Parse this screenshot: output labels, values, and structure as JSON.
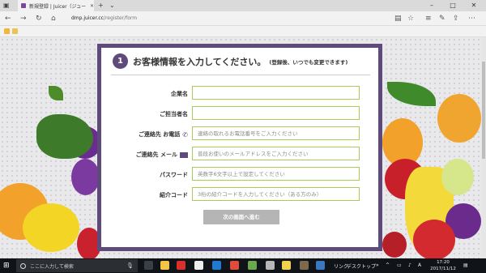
{
  "browser": {
    "tab_title": "新規登録 | Juicer（ジュー",
    "new_tab_symbol": "+",
    "url_domain": "dmp.juicer.cc",
    "url_path": "/register/form"
  },
  "form": {
    "step_number": "1",
    "title": "お客様情報を入力してください。",
    "note": "(登録後、いつでも変更できます)",
    "fields": [
      {
        "label": "企業名",
        "placeholder": ""
      },
      {
        "label": "ご担当者名",
        "placeholder": ""
      },
      {
        "label": "ご連絡先 お電話",
        "placeholder": "連絡の取れるお電話番号をご入力ください"
      },
      {
        "label": "ご連絡先 メール",
        "placeholder": "普段お使いのメールアドレスをご入力ください"
      },
      {
        "label": "パスワード",
        "placeholder": "英数字6文字以上で設定してください"
      },
      {
        "label": "紹介コード",
        "placeholder": "3桁の紹介コードを入力してください（ある方のみ）"
      }
    ],
    "next_button": "次の画面へ進む"
  },
  "taskbar": {
    "search_placeholder": "ここに入力して検索",
    "tray_link": "リンク",
    "tray_desktop": "デスクトップ",
    "time": "17:20",
    "date": "2017/11/12"
  },
  "colors": {
    "card_border": "#5e4b7c",
    "input_border": "#a8cc57",
    "button_disabled": "#b5b5b5"
  }
}
